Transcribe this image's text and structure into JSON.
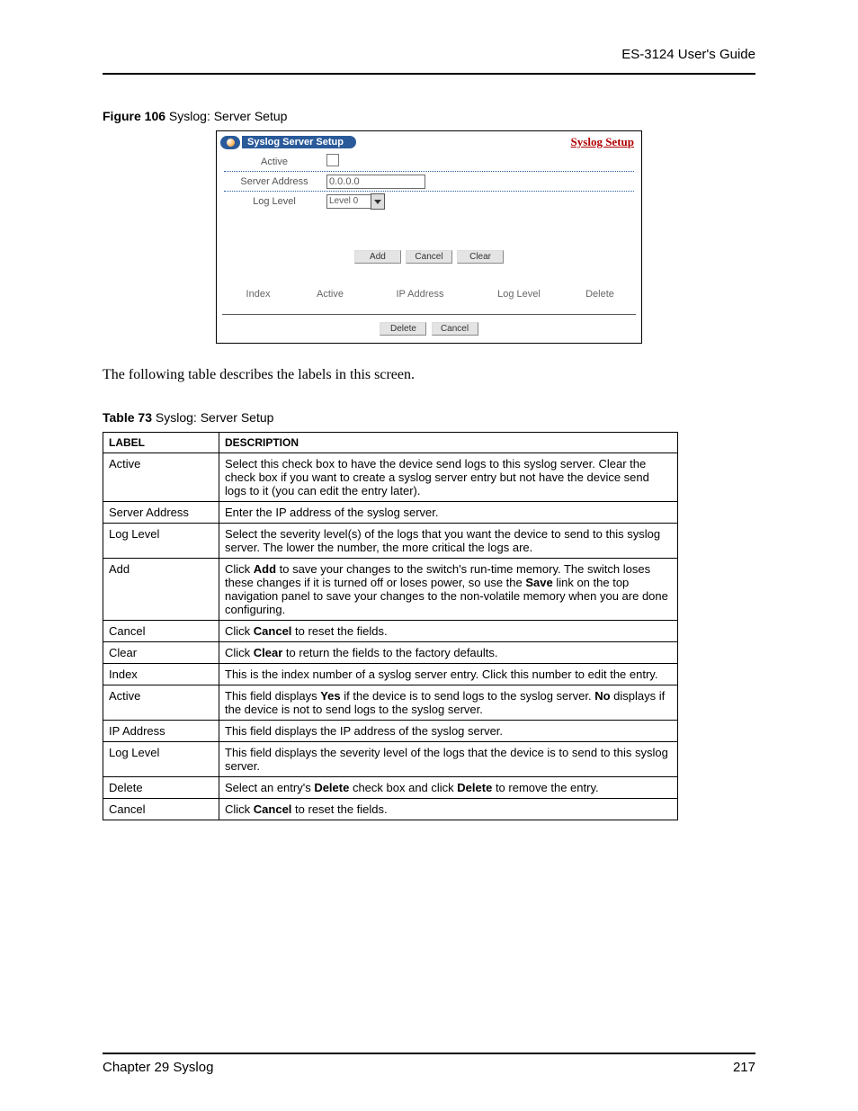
{
  "header": "ES-3124 User's Guide",
  "figure_caption": {
    "bold": "Figure 106",
    "rest": "   Syslog: Server Setup"
  },
  "screenshot": {
    "tab_title": "Syslog Server Setup",
    "link": "Syslog Setup",
    "rows": {
      "active_label": "Active",
      "server_addr_label": "Server Address",
      "server_addr_value": "0.0.0.0",
      "log_level_label": "Log Level",
      "log_level_value": "Level 0"
    },
    "buttons_top": [
      "Add",
      "Cancel",
      "Clear"
    ],
    "columns": [
      "Index",
      "Active",
      "IP Address",
      "Log Level",
      "Delete"
    ],
    "buttons_bot": [
      "Delete",
      "Cancel"
    ]
  },
  "para": "The following table describes the labels in this screen.",
  "table_caption": {
    "bold": "Table 73",
    "rest": "   Syslog: Server Setup"
  },
  "table_headers": [
    "LABEL",
    "DESCRIPTION"
  ],
  "table": [
    {
      "label": "Active",
      "desc": "Select this check box to have the device send logs to this syslog server. Clear the check box if you want to create a syslog server entry but not have the device send logs to it (you can edit the entry later)."
    },
    {
      "label": "Server Address",
      "desc": "Enter the IP address of the syslog server."
    },
    {
      "label": "Log Level",
      "desc": "Select the severity level(s) of the logs that you want the device to send to this syslog server. The lower the number, the more critical the logs are."
    },
    {
      "label": "Add",
      "desc_pre": "Click ",
      "b1": "Add",
      "desc_mid": " to save your changes to the switch's run-time memory. The switch loses these changes if it is turned off or loses power, so use the ",
      "b2": "Save",
      "desc_post": " link on the top navigation panel to save your changes to the non-volatile memory when you are done configuring."
    },
    {
      "label": "Cancel",
      "desc_pre": "Click ",
      "b1": "Cancel",
      "desc_post": " to reset the fields."
    },
    {
      "label": "Clear",
      "desc_pre": "Click ",
      "b1": "Clear",
      "desc_post": " to return the fields to the factory defaults."
    },
    {
      "label": "Index",
      "desc": "This is the index number of a syslog server entry. Click this number to edit the entry."
    },
    {
      "label": "Active",
      "desc_pre": "This field displays ",
      "b1": "Yes",
      "desc_mid": " if the device is to send logs to the syslog server. ",
      "b2": "No",
      "desc_post": " displays if the device is not to send logs to the syslog server."
    },
    {
      "label": "IP Address",
      "desc": "This field displays the IP address of the syslog server."
    },
    {
      "label": "Log Level",
      "desc": "This field displays the severity level of the logs that the device is to send to this syslog server."
    },
    {
      "label": "Delete",
      "desc_pre": "Select an entry's ",
      "b1": "Delete",
      "desc_mid": " check box and click ",
      "b2": "Delete",
      "desc_post": " to remove the entry."
    },
    {
      "label": "Cancel",
      "desc_pre": "Click ",
      "b1": "Cancel",
      "desc_post": " to reset the fields."
    }
  ],
  "footer": {
    "left": "Chapter 29 Syslog",
    "right": "217"
  }
}
